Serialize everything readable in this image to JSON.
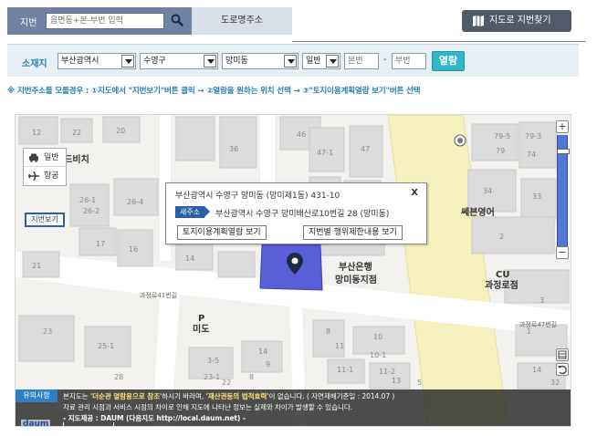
{
  "colors": {
    "tab_active": "#6f82a3",
    "tab_inactive": "#d9dfe9",
    "accent": "#31b8c8",
    "link_blue": "#2a7fb4",
    "parcel_highlight": "#5a5fd8",
    "road_yellow": "#f5f0c0",
    "zoom_track": "#5077d4"
  },
  "topbar": {
    "tab_jibeon": "지번",
    "search_placeholder": "읍면동+본-부번 입력",
    "search_icon": "search-icon",
    "tab_road": "도로명주소",
    "map_find_label": "지도로 지번찾기",
    "map_find_icon": "map-icon"
  },
  "location": {
    "label": "소재지",
    "sido": "부산광역시",
    "sigungu": "수영구",
    "dong": "망미동",
    "land_type": "일반",
    "main_no_placeholder": "본번",
    "sub_no_placeholder": "부번",
    "separator": "-",
    "open_label": "열람"
  },
  "notice": "※ 지번주소를 모를경우 : ①지도에서 \"지번보기\"버튼 클릭 → ②열람을 원하는 위치 선택 → ③\"토지이용계획열람 보기\"버튼 선택",
  "map": {
    "map_type": {
      "general": "일반",
      "aerial": "항공"
    },
    "jibeon_view": "지번보기",
    "zoom_in": "+",
    "zoom_out": "−",
    "zoom_level": 0.87,
    "popup": {
      "jibeon_addr": "부산광역시 수영구 망미동 (망미제1동) 431-10",
      "close": "X",
      "road_badge": "새주소",
      "road_addr": "부산광역시 수영구 망미배산로10번길 28 (망미동)",
      "btn_land_plan": "토지이용계획열람 보기",
      "btn_restriction": "지번별 행위제한내용 보기"
    },
    "pois": {
      "golf": "골드비치",
      "bank_line1": "부산은행",
      "bank_line2": "망미동지점",
      "english": "쎄븐영어",
      "cu_line1": "CU",
      "cu_line2": "과정로점",
      "parking_p": "P",
      "parking_label": "미도"
    },
    "streets": {
      "s1": "과정로41번길",
      "s2": "과정로47번길"
    },
    "blocks": [
      "12",
      "22",
      "20",
      "26-1",
      "26-2",
      "26-4",
      "21",
      "17",
      "16",
      "14",
      "47-1",
      "47",
      "46",
      "36",
      "48",
      "49",
      "79-5",
      "79-3",
      "79",
      "74",
      "34",
      "33",
      "2",
      "3",
      "1",
      "8",
      "10",
      "11",
      "10-1",
      "11-1",
      "11-2",
      "13",
      "14",
      "9",
      "8",
      "3-5",
      "23-1",
      "22",
      "23",
      "25-1",
      "14",
      "32",
      "28",
      "5"
    ]
  },
  "caution": {
    "badge": "유의사항",
    "line1_pre": "본지도는 ",
    "line1_b1": "'더순관 열람용으로 참조'",
    "line1_mid": "하시기 바라며, ",
    "line1_b2": "'재산권등의 법적효력'",
    "line1_post": "이 없습니다. ( 자연재해기준일 : 2014.07 )",
    "line2": "자료 관리 시점과 서비스 시점의 차이로 인해 지도에 나타난 정보는 실제와 차이가 발생할 수 있습니다.",
    "line3": "- 지도제공 : DAUM (다음지도 http://local.daum.net) -",
    "daum_logo": "daum"
  }
}
